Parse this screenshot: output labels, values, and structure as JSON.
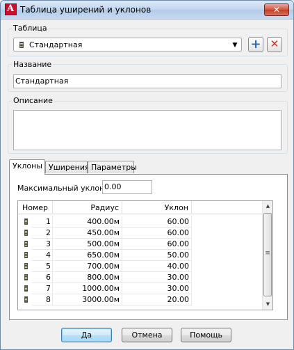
{
  "window": {
    "title": "Таблица уширений и уклонов",
    "close_glyph": "✕"
  },
  "table_group": {
    "label": "Таблица",
    "selected": "Стандартная",
    "add_glyph": "+",
    "delete_glyph": "✕"
  },
  "name_group": {
    "label": "Название",
    "value": "Стандартная"
  },
  "description_group": {
    "label": "Описание",
    "value": ""
  },
  "tabs": [
    {
      "label": "Уклоны",
      "active": true
    },
    {
      "label": "Уширения",
      "active": false
    },
    {
      "label": "Параметры",
      "active": false
    }
  ],
  "slopes": {
    "max_slope_label": "Максимальный уклон:",
    "max_slope_value": "0.00",
    "columns": [
      "Номер",
      "Радиус",
      "Уклон"
    ],
    "rows": [
      {
        "n": "1",
        "radius": "400.00м",
        "slope": "60.00"
      },
      {
        "n": "2",
        "radius": "450.00м",
        "slope": "60.00"
      },
      {
        "n": "3",
        "radius": "500.00м",
        "slope": "60.00"
      },
      {
        "n": "4",
        "radius": "650.00м",
        "slope": "50.00"
      },
      {
        "n": "5",
        "radius": "700.00м",
        "slope": "40.00"
      },
      {
        "n": "6",
        "radius": "800.00м",
        "slope": "30.00"
      },
      {
        "n": "7",
        "radius": "1000.00м",
        "slope": "30.00"
      },
      {
        "n": "8",
        "radius": "3000.00м",
        "slope": "20.00"
      }
    ]
  },
  "buttons": {
    "ok": "Да",
    "cancel": "Отмена",
    "help": "Помощь"
  },
  "colors": {
    "add_icon": "#2f6ab8",
    "delete_icon": "#d42a1a"
  }
}
